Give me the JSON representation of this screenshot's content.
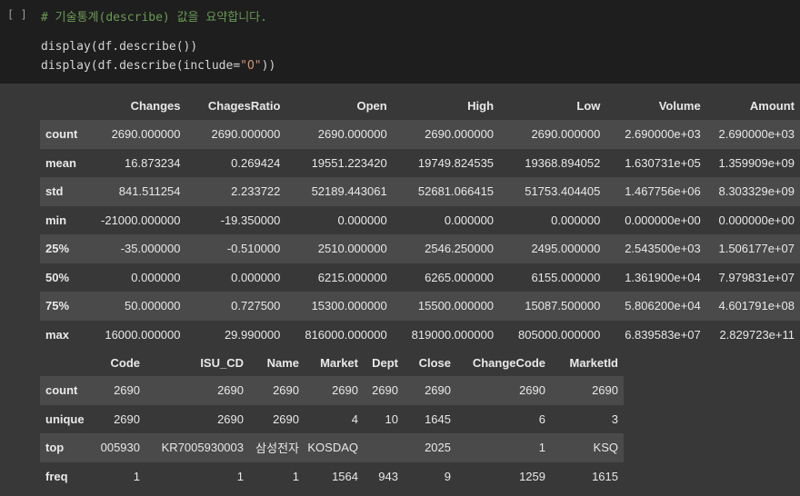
{
  "cell": {
    "run_indicator": "[ ]",
    "code_lines": [
      {
        "prefix": "",
        "comment": "# 기술통계(describe) 값을 요약합니다.",
        "string": "",
        "suffix": ""
      },
      {
        "prefix": "display(df.describe())",
        "comment": "",
        "string": "",
        "suffix": ""
      },
      {
        "prefix": "display(df.describe(include=",
        "comment": "",
        "string": "\"O\"",
        "suffix": "))"
      }
    ]
  },
  "table1": {
    "columns": [
      "Changes",
      "ChagesRatio",
      "Open",
      "High",
      "Low",
      "Volume",
      "Amount"
    ],
    "rows": [
      {
        "label": "count",
        "values": [
          "2690.000000",
          "2690.000000",
          "2690.000000",
          "2690.000000",
          "2690.000000",
          "2.690000e+03",
          "2.690000e+03"
        ]
      },
      {
        "label": "mean",
        "values": [
          "16.873234",
          "0.269424",
          "19551.223420",
          "19749.824535",
          "19368.894052",
          "1.630731e+05",
          "1.359909e+09"
        ]
      },
      {
        "label": "std",
        "values": [
          "841.511254",
          "2.233722",
          "52189.443061",
          "52681.066415",
          "51753.404405",
          "1.467756e+06",
          "8.303329e+09"
        ]
      },
      {
        "label": "min",
        "values": [
          "-21000.000000",
          "-19.350000",
          "0.000000",
          "0.000000",
          "0.000000",
          "0.000000e+00",
          "0.000000e+00"
        ]
      },
      {
        "label": "25%",
        "values": [
          "-35.000000",
          "-0.510000",
          "2510.000000",
          "2546.250000",
          "2495.000000",
          "2.543500e+03",
          "1.506177e+07"
        ]
      },
      {
        "label": "50%",
        "values": [
          "0.000000",
          "0.000000",
          "6215.000000",
          "6265.000000",
          "6155.000000",
          "1.361900e+04",
          "7.979831e+07"
        ]
      },
      {
        "label": "75%",
        "values": [
          "50.000000",
          "0.727500",
          "15300.000000",
          "15500.000000",
          "15087.500000",
          "5.806200e+04",
          "4.601791e+08"
        ]
      },
      {
        "label": "max",
        "values": [
          "16000.000000",
          "29.990000",
          "816000.000000",
          "819000.000000",
          "805000.000000",
          "6.839583e+07",
          "2.829723e+11"
        ]
      }
    ]
  },
  "table2": {
    "columns": [
      "Code",
      "ISU_CD",
      "Name",
      "Market",
      "Dept",
      "Close",
      "ChangeCode",
      "MarketId"
    ],
    "rows": [
      {
        "label": "count",
        "values": [
          "2690",
          "2690",
          "2690",
          "2690",
          "2690",
          "2690",
          "2690",
          "2690"
        ]
      },
      {
        "label": "unique",
        "values": [
          "2690",
          "2690",
          "2690",
          "4",
          "10",
          "1645",
          "6",
          "3"
        ]
      },
      {
        "label": "top",
        "values": [
          "005930",
          "KR7005930003",
          "삼성전자",
          "KOSDAQ",
          "",
          "2025",
          "1",
          "KSQ"
        ]
      },
      {
        "label": "freq",
        "values": [
          "1",
          "1",
          "1",
          "1564",
          "943",
          "9",
          "1259",
          "1615"
        ]
      }
    ]
  }
}
